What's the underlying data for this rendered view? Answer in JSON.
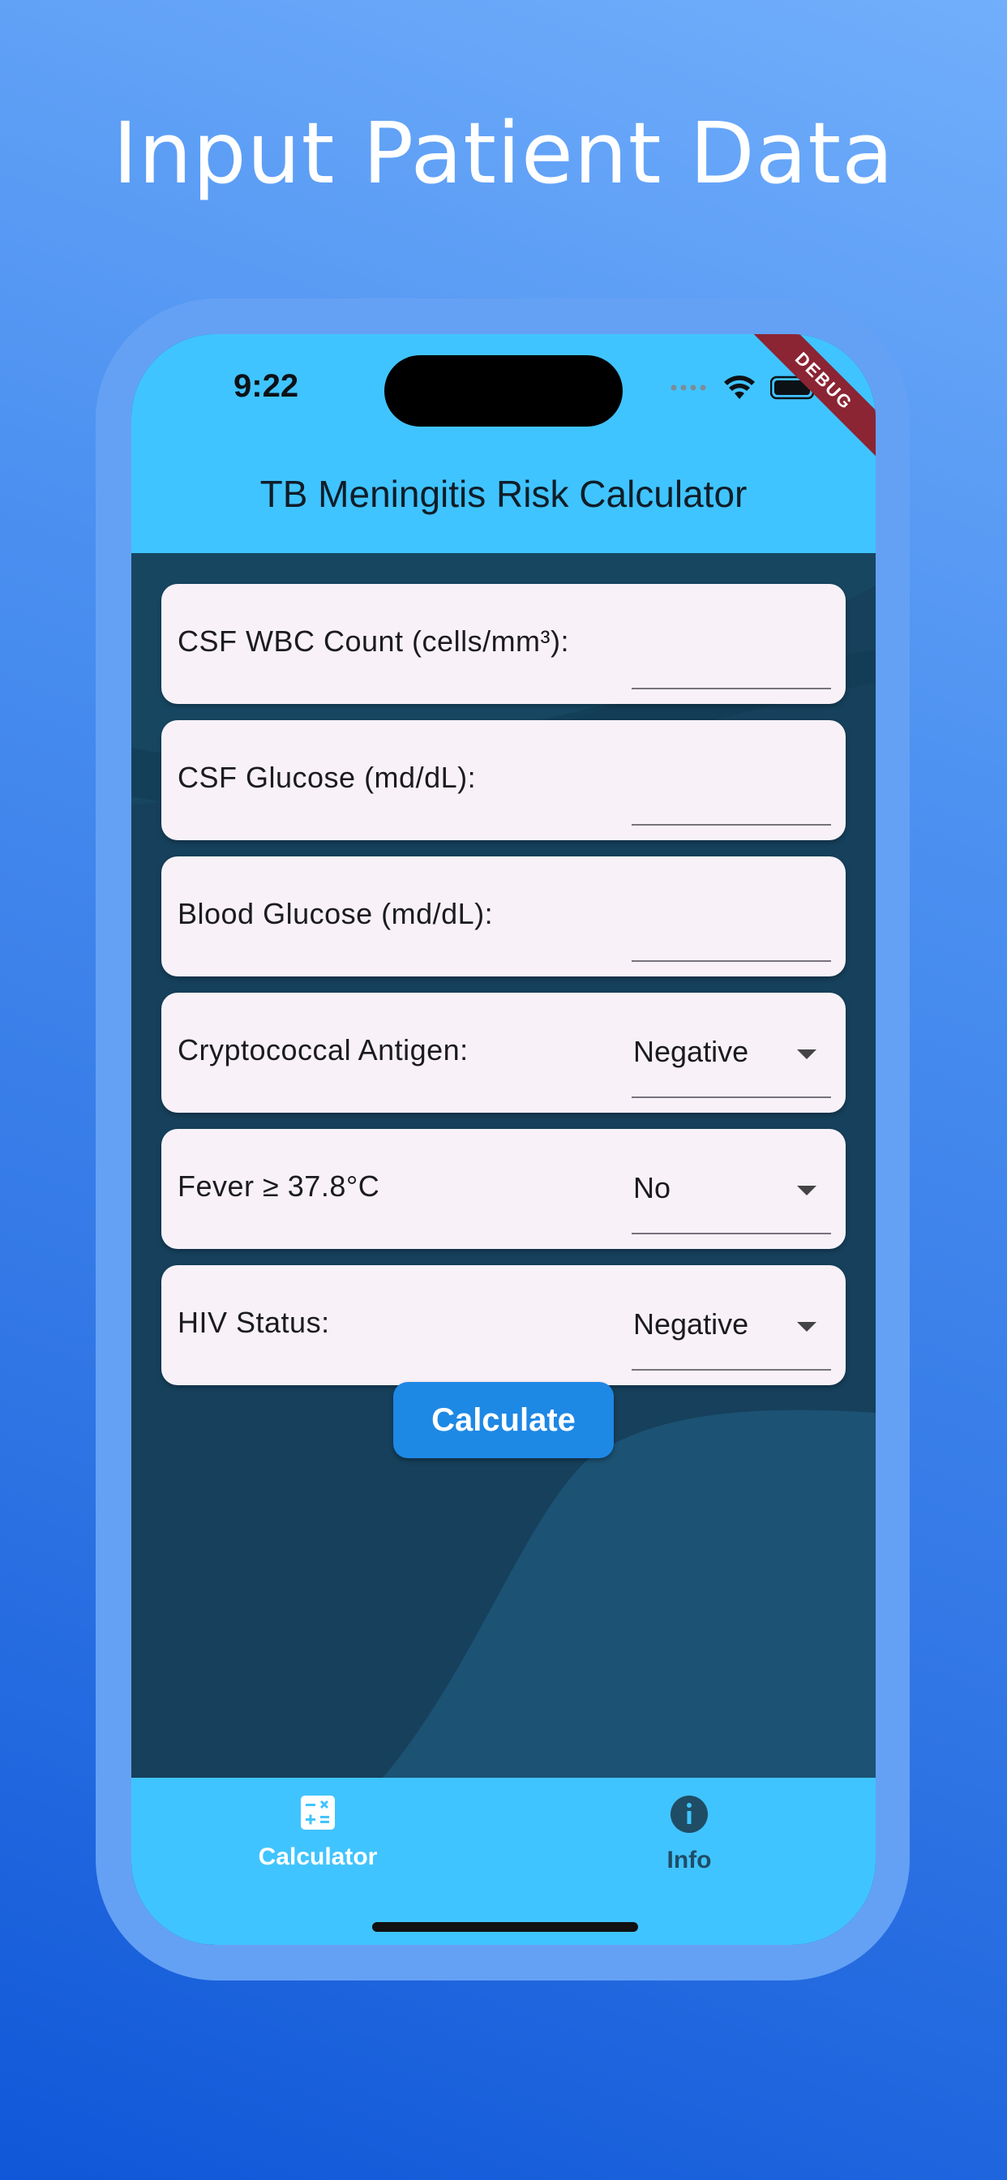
{
  "headline": "Input Patient Data",
  "status_bar": {
    "time": "9:22",
    "debug_label": "DEBUG"
  },
  "app": {
    "title": "TB Meningitis Risk Calculator"
  },
  "fields": {
    "csf_wbc": {
      "label": "CSF WBC Count (cells/mm³):",
      "value": ""
    },
    "csf_glucose": {
      "label": "CSF Glucose (md/dL):",
      "value": ""
    },
    "blood_glucose": {
      "label": "Blood Glucose (md/dL):",
      "value": ""
    },
    "crypto_antigen": {
      "label": "Cryptococcal Antigen:",
      "selected": "Negative"
    },
    "fever": {
      "label": "Fever ≥ 37.8°C",
      "selected": "No"
    },
    "hiv_status": {
      "label": "HIV Status:",
      "selected": "Negative"
    }
  },
  "calculate_label": "Calculate",
  "nav": {
    "calculator_label": "Calculator",
    "info_label": "Info",
    "calculator_icon": "calculator-icon",
    "info_icon": "info-icon"
  },
  "colors": {
    "app_bar": "#40c4ff",
    "content_bg": "#16405b",
    "button": "#1e88e5",
    "card": "#f8f1f8",
    "nav_active": "#ffffff",
    "nav_inactive": "#1f4d66"
  }
}
